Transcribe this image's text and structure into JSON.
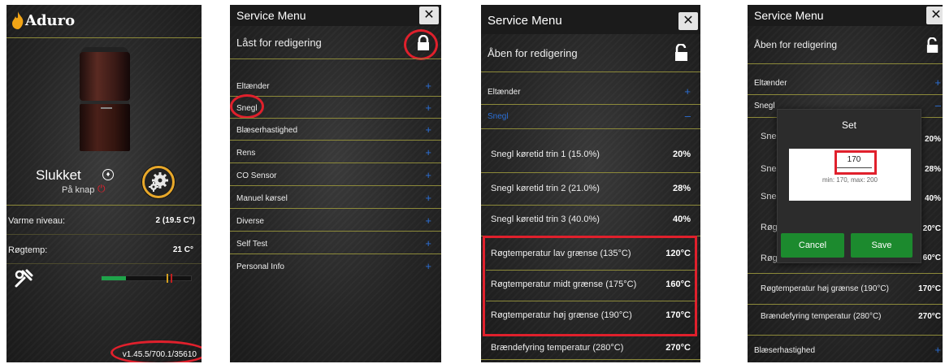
{
  "screen1": {
    "brand": "Aduro",
    "status": "Slukket",
    "substatus": "På knap",
    "heat_label": "Varme niveau:",
    "heat_value": "2 (19.5 C°)",
    "smoke_label": "Røgtemp:",
    "smoke_value": "21 C°",
    "version": "v1.45.5/700.1/35610"
  },
  "screen2": {
    "title": "Service Menu",
    "close": "✕",
    "lock_label": "Låst for redigering",
    "items": [
      "Eltænder",
      "Snegl",
      "Blæserhastighed",
      "Rens",
      "CO Sensor",
      "Manuel kørsel",
      "Diverse",
      "Self Test",
      "Personal Info"
    ],
    "plus": "+"
  },
  "screen3": {
    "title": "Service Menu",
    "close": "✕",
    "lock_label": "Åben for redigering",
    "group1": "Eltænder",
    "group2": "Snegl",
    "plus": "+",
    "minus": "–",
    "rows": [
      {
        "label": "Snegl køretid trin 1 (15.0%)",
        "value": "20%"
      },
      {
        "label": "Snegl køretid trin 2 (21.0%)",
        "value": "28%"
      },
      {
        "label": "Snegl køretid trin 3 (40.0%)",
        "value": "40%"
      },
      {
        "label": "Røgtemperatur lav grænse (135°C)",
        "value": "120°C"
      },
      {
        "label": "Røgtemperatur midt grænse (175°C)",
        "value": "160°C"
      },
      {
        "label": "Røgtemperatur høj grænse (190°C)",
        "value": "170°C"
      },
      {
        "label": "Brændefyring temperatur (280°C)",
        "value": "270°C"
      }
    ]
  },
  "screen4": {
    "title": "Service Menu",
    "close": "✕",
    "lock_label": "Åben for redigering",
    "group1": "Eltænder",
    "group2": "Snegl",
    "group3": "Blæserhastighed",
    "plus": "+",
    "minus": "–",
    "rows_left": [
      "Sneg",
      "Sneg",
      "Sneg",
      "Røgt",
      "Røgt"
    ],
    "rows_values": [
      "20%",
      "28%",
      "40%",
      "20°C",
      "60°C"
    ],
    "row6_label": "Røgtemperatur høj grænse (190°C)",
    "row6_value": "170°C",
    "row7_label": "Brændefyring temperatur (280°C)",
    "row7_value": "270°C",
    "dialog": {
      "title": "Set",
      "value": "170",
      "hint": "min: 170, max: 200",
      "cancel": "Cancel",
      "save": "Save"
    }
  },
  "colors": {
    "accent_red": "#e0202c",
    "green": "#1c8a2e",
    "separator": "#8d8a3a",
    "link_blue": "#2b6fd6"
  }
}
